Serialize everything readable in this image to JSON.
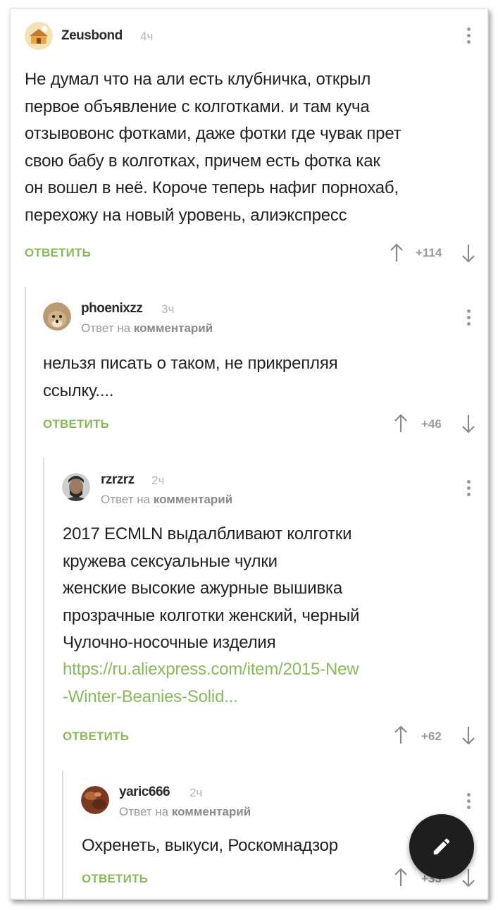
{
  "comments": [
    {
      "username": "Zeusbond",
      "time": "4ч",
      "text": "Не думал что на али есть клубничка, открыл\nпервое объявление с колготками. и там куча\nотзывовонс фотками, даже фотки где чувак прет\nсвою бабу в колготках, причем есть фотка как\nон вошел в неё. Короче теперь нафиг порнохаб,\nперехожу на новый уровень, алиэкспресс",
      "reply_label": "ОТВЕТИТЬ",
      "rating": "+114"
    },
    {
      "username": "phoenixzz",
      "time": "3ч",
      "reply_prefix": "Ответ на",
      "reply_target": "комментарий",
      "text": "нельзя писать о таком, не прикрепляя\nссылку....",
      "reply_label": "ОТВЕТИТЬ",
      "rating": "+46"
    },
    {
      "username": "rzrzrz",
      "time": "2ч",
      "reply_prefix": "Ответ на",
      "reply_target": "комментарий",
      "text": "2017 ECMLN выдалбливают колготки\nкружева сексуальные чулки\nженские высокие ажурные вышивка\nпрозрачные колготки женский, черный\nЧулочно-носочные изделия",
      "link": "https://ru.aliexpress.com/item/2015-New\n-Winter-Beanies-Solid...",
      "reply_label": "ОТВЕТИТЬ",
      "rating": "+62"
    },
    {
      "username": "yaric666",
      "time": "2ч",
      "reply_prefix": "Ответ на",
      "reply_target": "комментарий",
      "text": "Охренеть, выкуси, Роскомнадзор",
      "reply_label": "ОТВЕТИТЬ",
      "rating": "+33"
    }
  ],
  "fab": {
    "icon": "pencil-icon"
  },
  "colors": {
    "accent": "#8ab85a",
    "fab": "#1e1e1e",
    "text": "#222222",
    "muted": "#9a9a9a"
  }
}
